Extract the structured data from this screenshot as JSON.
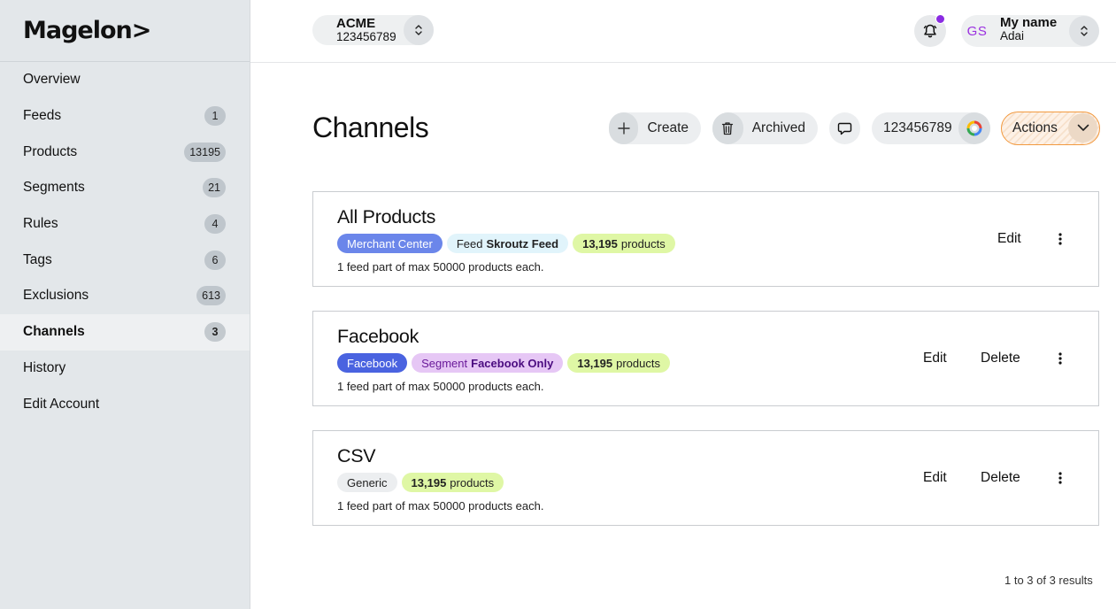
{
  "brand": {
    "logo": "Magelon>"
  },
  "sidebar": {
    "items": [
      {
        "label": "Overview",
        "badge": ""
      },
      {
        "label": "Feeds",
        "badge": "1"
      },
      {
        "label": "Products",
        "badge": "13195"
      },
      {
        "label": "Segments",
        "badge": "21"
      },
      {
        "label": "Rules",
        "badge": "4"
      },
      {
        "label": "Tags",
        "badge": "6"
      },
      {
        "label": "Exclusions",
        "badge": "613"
      },
      {
        "label": "Channels",
        "badge": "3",
        "active": true
      },
      {
        "label": "History",
        "badge": ""
      },
      {
        "label": "Edit Account",
        "badge": ""
      }
    ]
  },
  "topbar": {
    "org_name": "ACME",
    "org_id": "123456789",
    "user_initials": "GS",
    "user_name": "My name",
    "user_sub": "Adai",
    "notification_dot_color": "#8a2be2"
  },
  "page": {
    "title": "Channels",
    "create_label": "Create",
    "archived_label": "Archived",
    "account_id": "123456789",
    "actions_label": "Actions",
    "results_text": "1 to 3 of 3 results"
  },
  "channels": [
    {
      "title": "All Products",
      "tags": [
        {
          "kind": "mc",
          "text": "Merchant Center"
        },
        {
          "kind": "feed",
          "prefix": "Feed",
          "bold": "Skroutz Feed"
        },
        {
          "kind": "count",
          "bold": "13,195",
          "suffix": "products"
        }
      ],
      "note": "1 feed part of max 50000 products each.",
      "edit_label": "Edit",
      "delete_label": ""
    },
    {
      "title": "Facebook",
      "tags": [
        {
          "kind": "fb",
          "text": "Facebook"
        },
        {
          "kind": "seg",
          "prefix": "Segment",
          "bold": "Facebook Only"
        },
        {
          "kind": "count",
          "bold": "13,195",
          "suffix": "products"
        }
      ],
      "note": "1 feed part of max 50000 products each.",
      "edit_label": "Edit",
      "delete_label": "Delete"
    },
    {
      "title": "CSV",
      "tags": [
        {
          "kind": "gen",
          "text": "Generic"
        },
        {
          "kind": "count",
          "bold": "13,195",
          "suffix": "products"
        }
      ],
      "note": "1 feed part of max 50000 products each.",
      "edit_label": "Edit",
      "delete_label": "Delete"
    }
  ]
}
